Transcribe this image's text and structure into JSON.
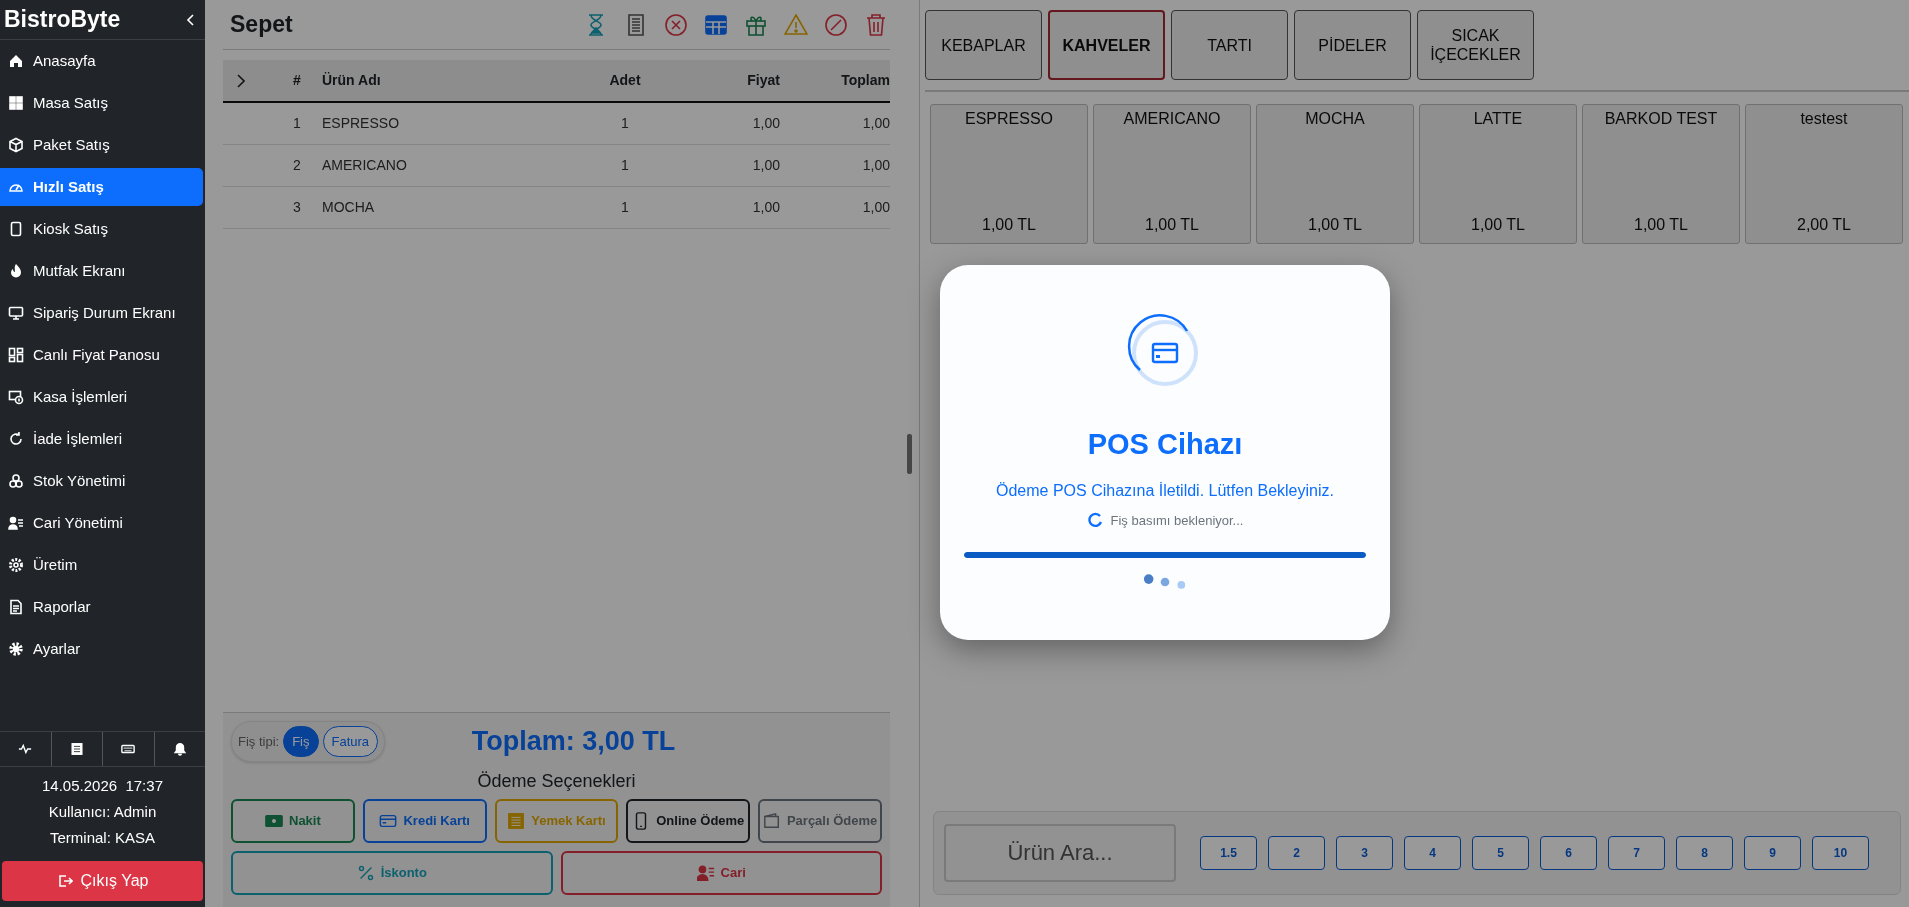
{
  "sidebar": {
    "brand": "BistroByte",
    "items": [
      {
        "label": "Anasayfa",
        "selected": false
      },
      {
        "label": "Masa Satış",
        "selected": false
      },
      {
        "label": "Paket Satış",
        "selected": false
      },
      {
        "label": "Hızlı Satış",
        "selected": true
      },
      {
        "label": "Kiosk Satış",
        "selected": false
      },
      {
        "label": "Mutfak Ekranı",
        "selected": false
      },
      {
        "label": "Sipariş Durum Ekranı",
        "selected": false
      },
      {
        "label": "Canlı Fiyat Panosu",
        "selected": false
      },
      {
        "label": "Kasa İşlemleri",
        "selected": false
      },
      {
        "label": "İade İşlemleri",
        "selected": false
      },
      {
        "label": "Stok Yönetimi",
        "selected": false
      },
      {
        "label": "Cari Yönetimi",
        "selected": false
      },
      {
        "label": "Üretim",
        "selected": false
      },
      {
        "label": "Raporlar",
        "selected": false
      },
      {
        "label": "Ayarlar",
        "selected": false
      }
    ],
    "date": "14.05.2026",
    "time": "17:37",
    "user": "Kullanıcı: Admin",
    "terminal": "Terminal: KASA",
    "logout": "Çıkış Yap"
  },
  "cart": {
    "title": "Sepet",
    "columns": [
      "#",
      "Ürün Adı",
      "Adet",
      "Fiyat",
      "Toplam"
    ],
    "rows": [
      [
        "1",
        "ESPRESSO",
        "1",
        "1,00",
        "1,00"
      ],
      [
        "2",
        "AMERICANO",
        "1",
        "1,00",
        "1,00"
      ],
      [
        "3",
        "MOCHA",
        "1",
        "1,00",
        "1,00"
      ]
    ],
    "receipt_type": {
      "label": "Fiş tipi:",
      "options": [
        {
          "label": "Fiş",
          "selected": true
        },
        {
          "label": "Fatura",
          "selected": false
        }
      ]
    },
    "total": "Toplam: 3,00 TL",
    "payment_title": "Ödeme Seçenekleri",
    "payments": [
      {
        "label": "Nakit",
        "kind": "cash"
      },
      {
        "label": "Kredi Kartı",
        "kind": "credit"
      },
      {
        "label": "Yemek Kartı",
        "kind": "meal"
      },
      {
        "label": "Online Ödeme",
        "kind": "online"
      },
      {
        "label": "Parçalı Ödeme",
        "kind": "split"
      }
    ],
    "actions": [
      {
        "label": "İskonto",
        "kind": "discount"
      },
      {
        "label": "Cari",
        "kind": "account"
      }
    ]
  },
  "categories": [
    {
      "label": "KEBAPLAR",
      "selected": false
    },
    {
      "label": "KAHVELER",
      "selected": true
    },
    {
      "label": "TARTI",
      "selected": false
    },
    {
      "label": "PİDELER",
      "selected": false
    },
    {
      "label": "SICAK İÇECEKLER",
      "selected": false
    }
  ],
  "products": [
    {
      "name": "ESPRESSO",
      "price": "1,00 TL"
    },
    {
      "name": "AMERICANO",
      "price": "1,00 TL"
    },
    {
      "name": "MOCHA",
      "price": "1,00 TL"
    },
    {
      "name": "LATTE",
      "price": "1,00 TL"
    },
    {
      "name": "BARKOD TEST",
      "price": "1,00 TL"
    },
    {
      "name": "testest",
      "price": "2,00 TL"
    }
  ],
  "search": {
    "placeholder": "Ürün Ara..."
  },
  "quantities": [
    "1.5",
    "2",
    "3",
    "4",
    "5",
    "6",
    "7",
    "8",
    "9",
    "10"
  ],
  "modal": {
    "title": "POS Cihazı",
    "message": "Ödeme POS Cihazına İletildi. Lütfen Bekleyiniz.",
    "status": "Fiş basımı bekleniyor...",
    "level": 1
  }
}
